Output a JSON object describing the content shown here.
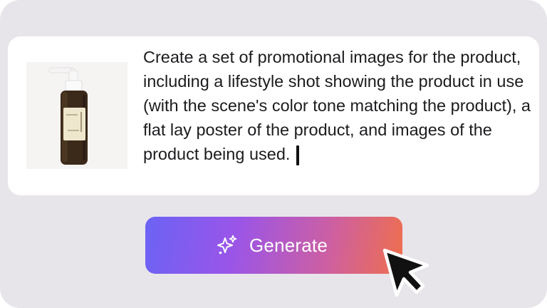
{
  "prompt": {
    "text": "Create a set of promotional images for the product, including a lifestyle shot showing the product in use (with the scene's color tone matching the product), a flat lay poster of the product, and images of the product being used.",
    "image_icon": "product-bottle-image"
  },
  "generate": {
    "label": "Generate",
    "icon": "sparkle-icon"
  },
  "cursor": {
    "icon": "mouse-pointer-icon"
  },
  "colors": {
    "background": "#e7e5ea",
    "card": "#ffffff",
    "button_gradient_start": "#6b63f5",
    "button_gradient_end": "#ef6f4d",
    "text": "#1c1c1f"
  }
}
